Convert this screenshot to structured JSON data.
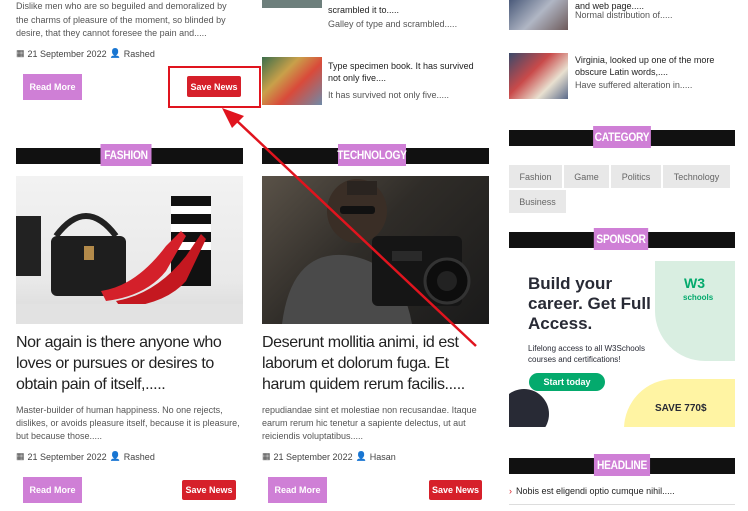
{
  "top_left": {
    "excerpt": "Dislike men who are so beguiled and demoralized by the charms of pleasure of the moment, so blinded by desire, that they cannot foresee the pain and.....",
    "date": "21 September 2022",
    "author": "Rashed",
    "read_more": "Read More",
    "save_news": "Save News"
  },
  "middle_list": [
    {
      "title": "scrambled it to.....",
      "excerpt": "Galley of type and scrambled....."
    },
    {
      "title": "Type specimen book. It has survived not only five....",
      "excerpt": "It has survived not only five....."
    }
  ],
  "right_list": [
    {
      "title": "and web page.....",
      "excerpt": "Normal distribution of....."
    },
    {
      "title": "Virginia, looked up one of the more obscure Latin words,....",
      "excerpt": "Have suffered alteration in....."
    }
  ],
  "sections": {
    "fashion": "FASHION",
    "technology": "TECHNOLOGY",
    "category": "CATEGORY",
    "sponsor": "SPONSOR",
    "headline": "HEADLINE"
  },
  "fashion_card": {
    "title": "Nor again is there anyone who loves or pursues or desires to obtain pain of itself,.....",
    "excerpt": "Master-builder of human happiness. No one rejects, dislikes, or avoids pleasure itself, because it is pleasure, but because those.....",
    "date": "21 September 2022",
    "author": "Rashed",
    "read_more": "Read More",
    "save_news": "Save News"
  },
  "tech_card": {
    "title": "Deserunt mollitia animi, id est laborum et dolorum fuga. Et harum quidem rerum facilis.....",
    "excerpt": "repudiandae sint et molestiae non recusandae. Itaque earum rerum hic tenetur a sapiente delectus, ut aut reiciendis voluptatibus.....",
    "date": "21 September 2022",
    "author": "Hasan",
    "read_more": "Read More",
    "save_news": "Save News"
  },
  "categories": [
    "Fashion",
    "Game",
    "Politics",
    "Technology",
    "Business"
  ],
  "sponsor_ad": {
    "headline": "Build your career. Get Full Access.",
    "sub": "Lifelong access to all W3Schools courses and certifications!",
    "cta": "Start today",
    "save": "SAVE 770$",
    "brand_mark": "W3",
    "brand_name": "schools"
  },
  "headline_item": "Nobis est eligendi optio cumque nihil.....",
  "colors": {
    "accent": "#cf7fd6",
    "save": "#d6202a",
    "bar": "#111111",
    "annotation": "#e0141e",
    "ad_green": "#04aa6d"
  }
}
